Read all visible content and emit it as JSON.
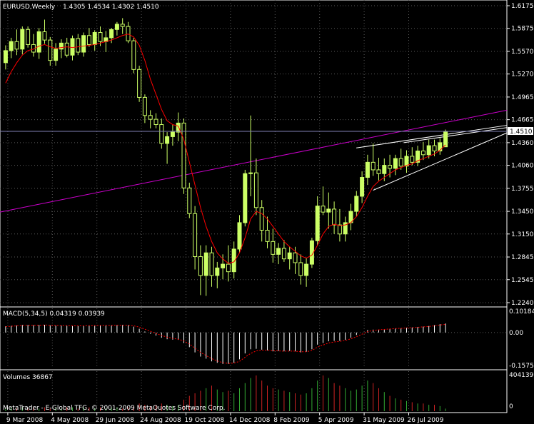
{
  "colors": {
    "background": "#000000",
    "grid": "#5a5a5a",
    "bull": "#ccff66",
    "bear": "#000000",
    "bear_outline": "#ccff66",
    "ma_line": "#ff0000",
    "channel_line": "#cc00cc",
    "wedge_line": "#ffffff",
    "price_line": "#7f7fb4",
    "vol_up": "#33aa33",
    "vol_down": "#cc2222",
    "macd_hist": "#ffffff",
    "macd_signal": "#ff0000"
  },
  "main_chart": {
    "header": {
      "symbol": "EURUSD,Weekly",
      "ohlc": "1.4305 1.4534 1.4302 1.4510"
    },
    "price_ticks": [
      "1.6175",
      "1.5875",
      "1.5570",
      "1.5270",
      "1.4965",
      "1.4665",
      "1.4360",
      "1.4060",
      "1.3755",
      "1.3450",
      "1.3150",
      "1.2845",
      "1.2545",
      "1.2240"
    ],
    "current_price": "1.4510"
  },
  "macd": {
    "header": "MACD(5,34,5) 0.04319 0.03939",
    "ticks": [
      "0.10184",
      "0.00",
      "-0.15753"
    ]
  },
  "volumes": {
    "header": "Volumes 36867",
    "ticks": [
      "404139",
      "0"
    ],
    "footer": "MetaTrader - E-Global TFG, © 2001-2009 MetaQuotes Software Corp."
  },
  "x_axis": {
    "labels": [
      "9 Mar 2008",
      "4 May 2008",
      "29 Jun 2008",
      "24 Aug 2008",
      "19 Oct 2008",
      "14 Dec 2008",
      "8 Feb 2009",
      "5 Apr 2009",
      "31 May 2009",
      "26 Jul 2009"
    ]
  },
  "chart_data": {
    "type": "candlestick",
    "title": "EURUSD,Weekly",
    "timeframe": "Weekly",
    "ylim": [
      1.224,
      1.6175
    ],
    "x_tick_labels": [
      "9 Mar 2008",
      "4 May 2008",
      "29 Jun 2008",
      "24 Aug 2008",
      "19 Oct 2008",
      "14 Dec 2008",
      "8 Feb 2009",
      "5 Apr 2009",
      "31 May 2009",
      "26 Jul 2009"
    ],
    "ohlc": [
      [
        1.542,
        1.565,
        1.533,
        1.558
      ],
      [
        1.558,
        1.575,
        1.548,
        1.57
      ],
      [
        1.57,
        1.586,
        1.552,
        1.56
      ],
      [
        1.56,
        1.59,
        1.553,
        1.586
      ],
      [
        1.586,
        1.59,
        1.562,
        1.566
      ],
      [
        1.566,
        1.58,
        1.55,
        1.556
      ],
      [
        1.556,
        1.588,
        1.547,
        1.583
      ],
      [
        1.583,
        1.599,
        1.567,
        1.572
      ],
      [
        1.572,
        1.576,
        1.538,
        1.545
      ],
      [
        1.545,
        1.568,
        1.538,
        1.56
      ],
      [
        1.56,
        1.573,
        1.548,
        1.568
      ],
      [
        1.568,
        1.575,
        1.549,
        1.552
      ],
      [
        1.552,
        1.578,
        1.545,
        1.574
      ],
      [
        1.574,
        1.58,
        1.552,
        1.556
      ],
      [
        1.556,
        1.582,
        1.55,
        1.578
      ],
      [
        1.578,
        1.588,
        1.563,
        1.566
      ],
      [
        1.566,
        1.585,
        1.558,
        1.582
      ],
      [
        1.582,
        1.59,
        1.564,
        1.57
      ],
      [
        1.57,
        1.584,
        1.556,
        1.575
      ],
      [
        1.575,
        1.588,
        1.568,
        1.586
      ],
      [
        1.586,
        1.596,
        1.578,
        1.593
      ],
      [
        1.593,
        1.601,
        1.58,
        1.59
      ],
      [
        1.59,
        1.596,
        1.568,
        1.571
      ],
      [
        1.571,
        1.575,
        1.528,
        1.533
      ],
      [
        1.533,
        1.538,
        1.49,
        1.496
      ],
      [
        1.496,
        1.5,
        1.462,
        1.472
      ],
      [
        1.472,
        1.479,
        1.455,
        1.467
      ],
      [
        1.467,
        1.475,
        1.455,
        1.46
      ],
      [
        1.46,
        1.468,
        1.428,
        1.435
      ],
      [
        1.435,
        1.45,
        1.408,
        1.444
      ],
      [
        1.444,
        1.46,
        1.432,
        1.45
      ],
      [
        1.45,
        1.476,
        1.438,
        1.462
      ],
      [
        1.462,
        1.468,
        1.368,
        1.376
      ],
      [
        1.376,
        1.383,
        1.336,
        1.342
      ],
      [
        1.342,
        1.352,
        1.268,
        1.285
      ],
      [
        1.285,
        1.3,
        1.234,
        1.26
      ],
      [
        1.26,
        1.3,
        1.233,
        1.29
      ],
      [
        1.29,
        1.298,
        1.245,
        1.26
      ],
      [
        1.26,
        1.278,
        1.243,
        1.27
      ],
      [
        1.27,
        1.288,
        1.255,
        1.275
      ],
      [
        1.275,
        1.3,
        1.252,
        1.265
      ],
      [
        1.265,
        1.305,
        1.256,
        1.295
      ],
      [
        1.295,
        1.34,
        1.29,
        1.33
      ],
      [
        1.33,
        1.4,
        1.325,
        1.395
      ],
      [
        1.395,
        1.472,
        1.365,
        1.396
      ],
      [
        1.396,
        1.415,
        1.34,
        1.35
      ],
      [
        1.35,
        1.36,
        1.305,
        1.32
      ],
      [
        1.32,
        1.338,
        1.296,
        1.305
      ],
      [
        1.305,
        1.322,
        1.277,
        1.288
      ],
      [
        1.288,
        1.303,
        1.275,
        1.296
      ],
      [
        1.296,
        1.307,
        1.278,
        1.282
      ],
      [
        1.282,
        1.298,
        1.268,
        1.29
      ],
      [
        1.29,
        1.298,
        1.262,
        1.277
      ],
      [
        1.277,
        1.288,
        1.248,
        1.26
      ],
      [
        1.26,
        1.283,
        1.245,
        1.275
      ],
      [
        1.275,
        1.31,
        1.27,
        1.306
      ],
      [
        1.306,
        1.365,
        1.3,
        1.352
      ],
      [
        1.352,
        1.378,
        1.34,
        1.344
      ],
      [
        1.344,
        1.37,
        1.322,
        1.348
      ],
      [
        1.348,
        1.358,
        1.315,
        1.327
      ],
      [
        1.327,
        1.348,
        1.305,
        1.315
      ],
      [
        1.315,
        1.338,
        1.305,
        1.33
      ],
      [
        1.33,
        1.355,
        1.32,
        1.345
      ],
      [
        1.345,
        1.372,
        1.338,
        1.365
      ],
      [
        1.365,
        1.398,
        1.356,
        1.39
      ],
      [
        1.39,
        1.42,
        1.38,
        1.41
      ],
      [
        1.41,
        1.435,
        1.392,
        1.4
      ],
      [
        1.4,
        1.416,
        1.386,
        1.395
      ],
      [
        1.395,
        1.415,
        1.385,
        1.406
      ],
      [
        1.406,
        1.42,
        1.39,
        1.402
      ],
      [
        1.402,
        1.42,
        1.393,
        1.415
      ],
      [
        1.415,
        1.428,
        1.4,
        1.405
      ],
      [
        1.405,
        1.426,
        1.396,
        1.418
      ],
      [
        1.418,
        1.43,
        1.406,
        1.41
      ],
      [
        1.41,
        1.432,
        1.405,
        1.425
      ],
      [
        1.425,
        1.437,
        1.413,
        1.42
      ],
      [
        1.42,
        1.44,
        1.415,
        1.432
      ],
      [
        1.432,
        1.44,
        1.418,
        1.425
      ],
      [
        1.425,
        1.442,
        1.42,
        1.436
      ],
      [
        1.4305,
        1.4534,
        1.4302,
        1.451
      ]
    ],
    "moving_average": [
      1.515,
      1.53,
      1.542,
      1.552,
      1.558,
      1.56,
      1.564,
      1.566,
      1.563,
      1.561,
      1.562,
      1.563,
      1.562,
      1.563,
      1.564,
      1.565,
      1.566,
      1.568,
      1.57,
      1.572,
      1.575,
      1.578,
      1.58,
      1.576,
      1.565,
      1.545,
      1.52,
      1.5,
      1.48,
      1.465,
      1.46,
      1.458,
      1.44,
      1.41,
      1.38,
      1.35,
      1.325,
      1.305,
      1.29,
      1.282,
      1.276,
      1.278,
      1.29,
      1.31,
      1.335,
      1.345,
      1.342,
      1.335,
      1.325,
      1.315,
      1.305,
      1.298,
      1.292,
      1.286,
      1.283,
      1.287,
      1.3,
      1.315,
      1.325,
      1.328,
      1.326,
      1.327,
      1.33,
      1.338,
      1.35,
      1.365,
      1.378,
      1.385,
      1.39,
      1.395,
      1.4,
      1.403,
      1.406,
      1.408,
      1.412,
      1.415,
      1.418,
      1.421,
      1.426,
      1.433
    ],
    "macd_values": [
      0.03,
      0.032,
      0.034,
      0.036,
      0.036,
      0.035,
      0.036,
      0.037,
      0.034,
      0.033,
      0.033,
      0.032,
      0.032,
      0.032,
      0.033,
      0.033,
      0.034,
      0.034,
      0.034,
      0.035,
      0.036,
      0.036,
      0.035,
      0.028,
      0.018,
      0.005,
      -0.006,
      -0.015,
      -0.025,
      -0.032,
      -0.034,
      -0.035,
      -0.05,
      -0.07,
      -0.095,
      -0.115,
      -0.125,
      -0.138,
      -0.145,
      -0.15,
      -0.15,
      -0.145,
      -0.128,
      -0.1,
      -0.08,
      -0.078,
      -0.082,
      -0.085,
      -0.09,
      -0.088,
      -0.09,
      -0.088,
      -0.09,
      -0.095,
      -0.092,
      -0.08,
      -0.058,
      -0.05,
      -0.042,
      -0.04,
      -0.04,
      -0.035,
      -0.025,
      -0.012,
      0.0,
      0.012,
      0.014,
      0.015,
      0.016,
      0.018,
      0.02,
      0.021,
      0.023,
      0.024,
      0.026,
      0.028,
      0.031,
      0.035,
      0.04,
      0.043
    ],
    "macd_signal": [
      0.028,
      0.03,
      0.032,
      0.034,
      0.035,
      0.035,
      0.035,
      0.036,
      0.035,
      0.034,
      0.033,
      0.033,
      0.032,
      0.032,
      0.032,
      0.033,
      0.033,
      0.034,
      0.034,
      0.034,
      0.035,
      0.035,
      0.035,
      0.032,
      0.026,
      0.016,
      0.006,
      -0.004,
      -0.014,
      -0.022,
      -0.028,
      -0.032,
      -0.04,
      -0.055,
      -0.075,
      -0.095,
      -0.11,
      -0.125,
      -0.136,
      -0.144,
      -0.148,
      -0.146,
      -0.138,
      -0.118,
      -0.1,
      -0.088,
      -0.084,
      -0.084,
      -0.087,
      -0.088,
      -0.089,
      -0.089,
      -0.089,
      -0.092,
      -0.092,
      -0.086,
      -0.07,
      -0.06,
      -0.05,
      -0.045,
      -0.042,
      -0.038,
      -0.03,
      -0.02,
      -0.008,
      0.004,
      0.01,
      0.013,
      0.015,
      0.017,
      0.019,
      0.02,
      0.022,
      0.023,
      0.025,
      0.027,
      0.029,
      0.032,
      0.036,
      0.039
    ],
    "volumes": [
      2,
      3,
      2,
      3,
      2,
      3,
      2,
      3,
      2,
      3,
      2,
      3,
      3,
      2,
      3,
      3,
      2,
      3,
      2,
      3,
      3,
      2,
      3,
      4,
      6,
      5,
      4,
      5,
      6,
      5,
      4,
      5,
      9,
      12,
      14,
      16,
      18,
      20,
      17,
      15,
      16,
      14,
      18,
      22,
      26,
      28,
      24,
      20,
      18,
      17,
      16,
      15,
      14,
      13,
      14,
      18,
      24,
      28,
      26,
      22,
      20,
      18,
      16,
      17,
      20,
      24,
      22,
      18,
      15,
      12,
      10,
      9,
      8,
      7,
      6,
      6,
      5,
      5,
      4,
      2
    ],
    "volume_ylim": [
      0,
      404139
    ]
  }
}
